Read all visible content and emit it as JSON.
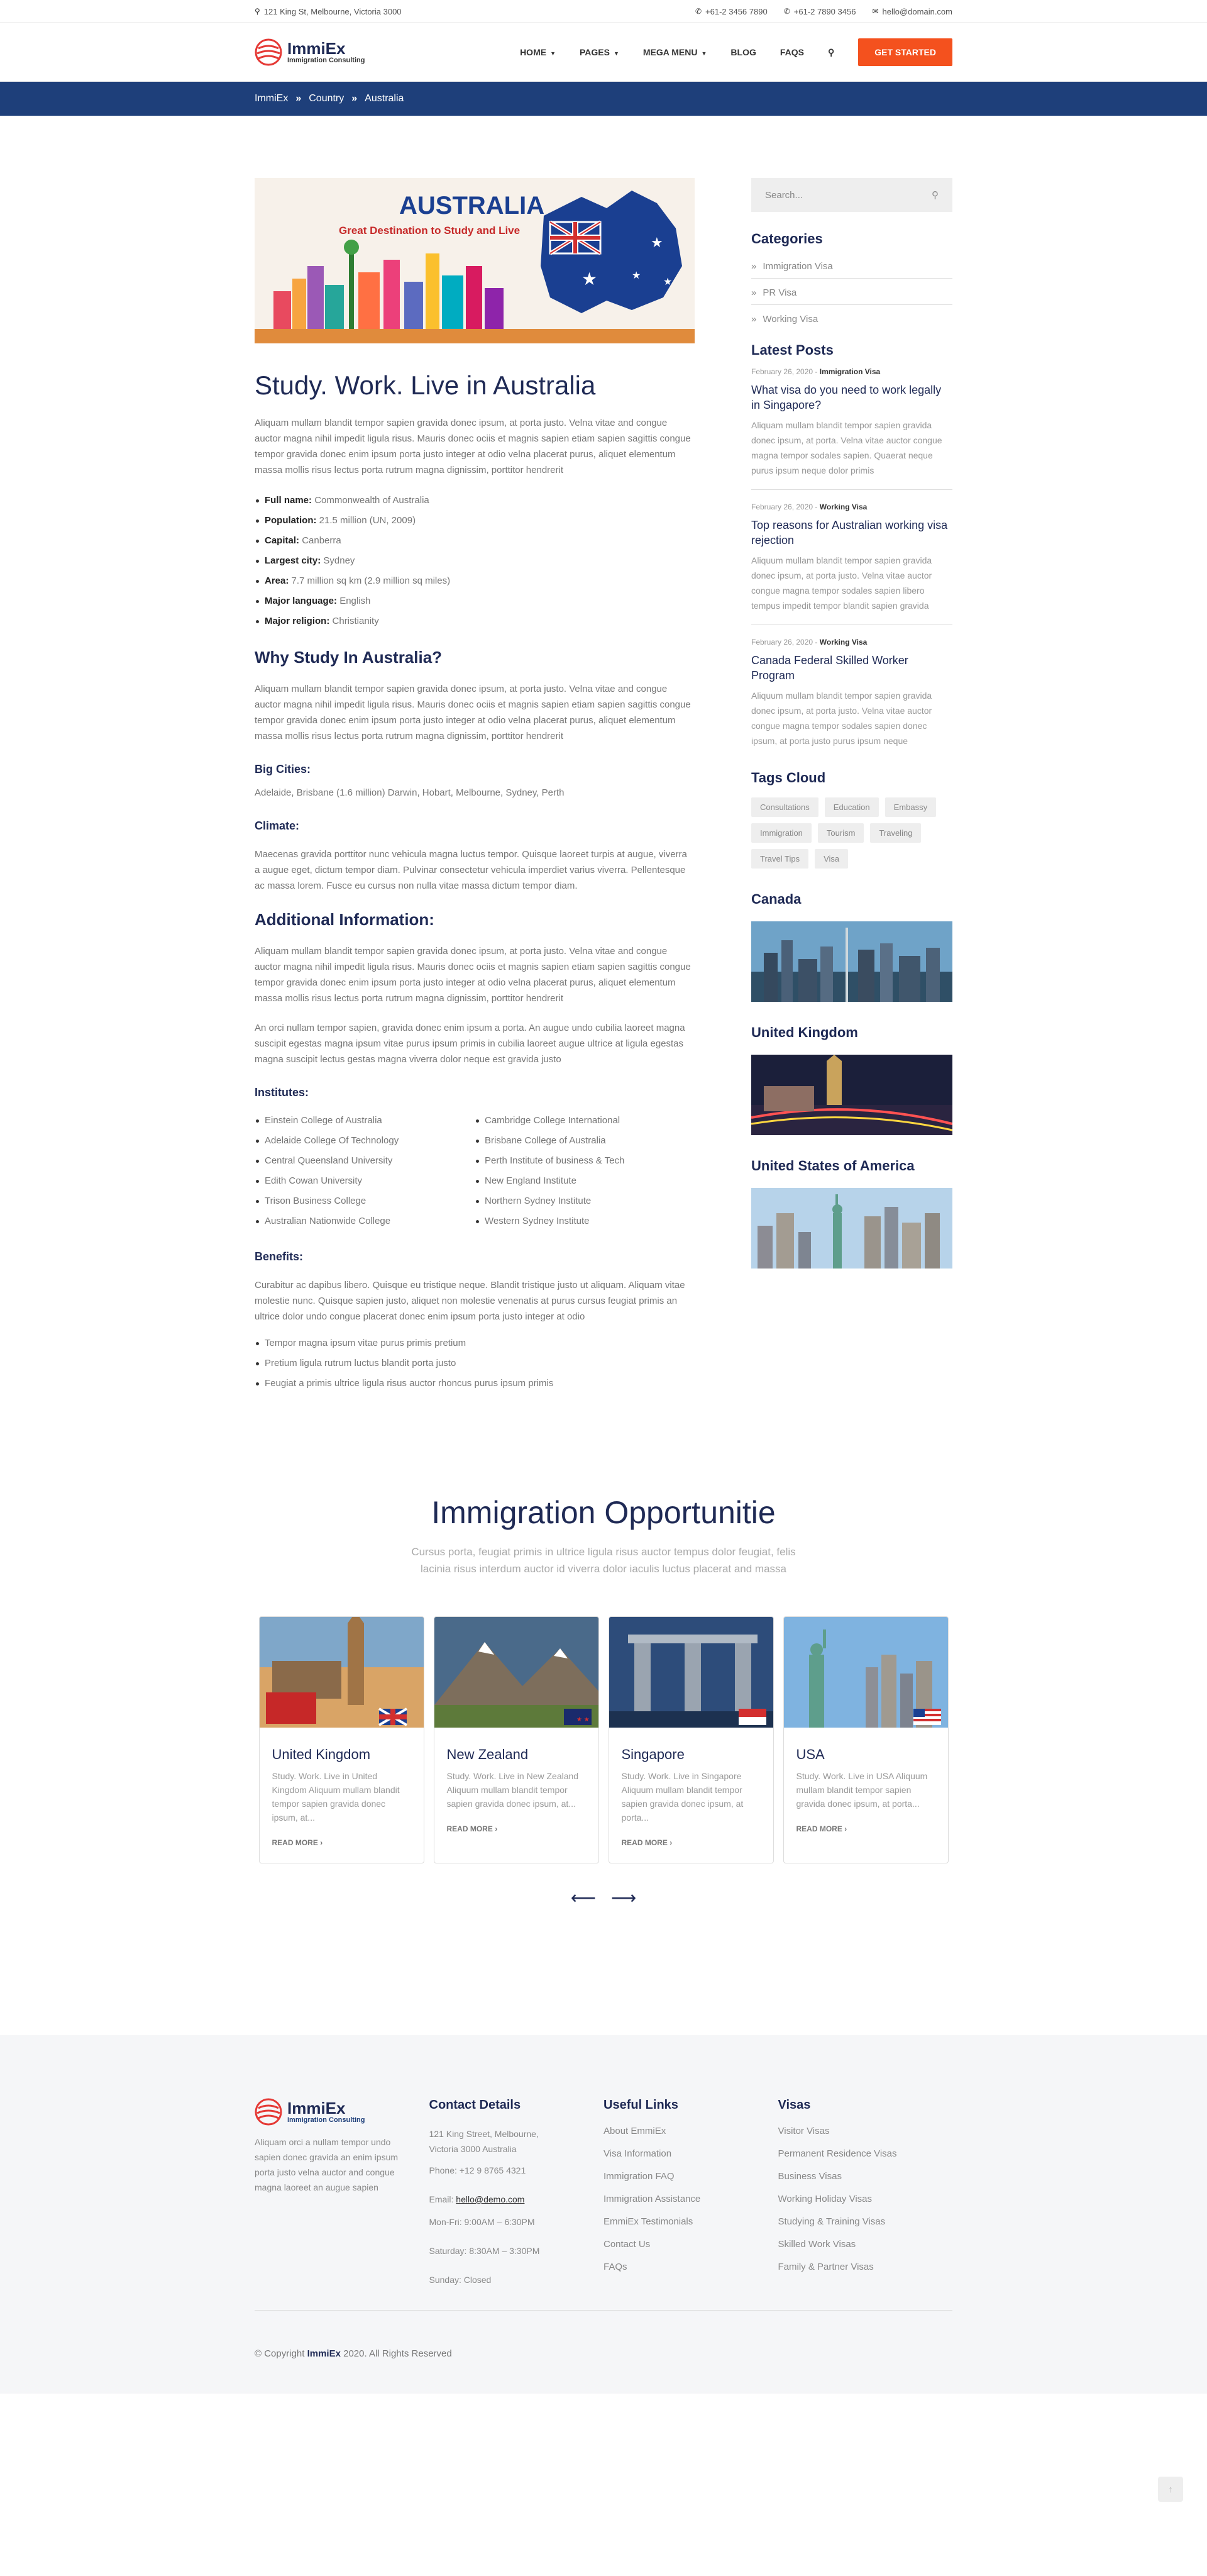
{
  "topbar": {
    "address": "121 King St, Melbourne, Victoria 3000",
    "phone1": "+61-2 3456 7890",
    "phone2": "+61-2 7890 3456",
    "email": "hello@domain.com"
  },
  "brand": {
    "name": "ImmiEx",
    "tagline": "Immigration Consulting"
  },
  "nav": {
    "home": "HOME",
    "pages": "PAGES",
    "mega": "MEGA MENU",
    "blog": "BLOG",
    "faqs": "FAQS",
    "cta": "GET STARTED"
  },
  "breadcrumb": [
    "ImmiEx",
    "Country",
    "Australia"
  ],
  "banner": {
    "title": "AUSTRALIA",
    "subtitle": "Great Destination to Study and Live"
  },
  "article": {
    "title": "Study. Work. Live in Australia",
    "intro": "Aliquam mullam blandit tempor sapien gravida donec ipsum, at porta justo. Velna vitae and congue auctor magna nihil impedit ligula risus. Mauris donec ociis et magnis sapien etiam sapien sagittis congue tempor gravida donec enim ipsum porta justo integer at odio velna placerat purus, aliquet elementum massa mollis risus lectus porta rutrum magna dignissim, porttitor hendrerit",
    "facts": [
      {
        "label": "Full name:",
        "value": "Commonwealth of Australia"
      },
      {
        "label": "Population:",
        "value": "21.5 million (UN, 2009)"
      },
      {
        "label": "Capital:",
        "value": "Canberra"
      },
      {
        "label": "Largest city:",
        "value": "Sydney"
      },
      {
        "label": "Area:",
        "value": "7.7 million sq km (2.9 million sq miles)"
      },
      {
        "label": "Major language:",
        "value": "English"
      },
      {
        "label": "Major religion:",
        "value": "Christianity"
      }
    ],
    "why_title": "Why Study In Australia?",
    "why_text": "Aliquam mullam blandit tempor sapien gravida donec ipsum, at porta justo. Velna vitae and congue auctor magna nihil impedit ligula risus. Mauris donec ociis et magnis sapien etiam sapien sagittis congue tempor gravida donec enim ipsum porta justo integer at odio velna placerat purus, aliquet elementum massa mollis risus lectus porta rutrum magna dignissim, porttitor hendrerit",
    "cities_title": "Big Cities:",
    "cities_text": "Adelaide, Brisbane (1.6 million) Darwin, Hobart, Melbourne, Sydney, Perth",
    "climate_title": "Climate:",
    "climate_text": "Maecenas gravida porttitor nunc vehicula magna luctus tempor. Quisque laoreet turpis at augue, viverra a augue eget, dictum tempor diam. Pulvinar consectetur vehicula imperdiet varius viverra. Pellentesque ac massa lorem. Fusce eu cursus non nulla vitae massa dictum tempor diam.",
    "add_title": "Additional Information:",
    "add_text1": "Aliquam mullam blandit tempor sapien gravida donec ipsum, at porta justo. Velna vitae and congue auctor magna nihil impedit ligula risus. Mauris donec ociis et magnis sapien etiam sapien sagittis congue tempor gravida donec enim ipsum porta justo integer at odio velna placerat purus, aliquet elementum massa mollis risus lectus porta rutrum magna dignissim, porttitor hendrerit",
    "add_text2": "An orci nullam tempor sapien, gravida donec enim ipsum a porta. An augue undo cubilia laoreet magna suscipit egestas magna ipsum vitae purus ipsum primis in cubilia laoreet augue ultrice at ligula egestas magna suscipit lectus gestas magna viverra dolor neque est gravida justo",
    "inst_title": "Institutes:",
    "inst_left": [
      "Einstein College of Australia",
      "Adelaide College Of Technology",
      "Central Queensland University",
      "Edith Cowan University",
      "Trison Business College",
      "Australian Nationwide College"
    ],
    "inst_right": [
      "Cambridge College International",
      "Brisbane College of Australia",
      "Perth Institute of business & Tech",
      "New England Institute",
      "Northern Sydney Institute",
      "Western Sydney Institute"
    ],
    "ben_title": "Benefits:",
    "ben_text": "Curabitur ac dapibus libero. Quisque eu tristique neque. Blandit tristique justo ut aliquam. Aliquam vitae molestie nunc. Quisque sapien justo, aliquet non molestie venenatis at purus cursus feugiat primis an ultrice dolor undo congue placerat donec enim ipsum porta justo integer at odio",
    "benefits": [
      "Tempor magna ipsum vitae purus primis pretium",
      "Pretium ligula rutrum luctus blandit porta justo",
      "Feugiat a primis ultrice ligula risus auctor rhoncus purus ipsum primis"
    ]
  },
  "sidebar": {
    "search_placeholder": "Search...",
    "categories_title": "Categories",
    "categories": [
      "Immigration Visa",
      "PR Visa",
      "Working Visa"
    ],
    "latest_title": "Latest Posts",
    "posts": [
      {
        "date": "February 26, 2020 -",
        "cat": "Immigration Visa",
        "title": "What visa do you need to work legally in Singapore?",
        "excerpt": "Aliquam mullam blandit tempor sapien gravida donec ipsum, at porta. Velna vitae auctor congue magna tempor sodales sapien. Quaerat neque purus ipsum neque dolor primis"
      },
      {
        "date": "February 26, 2020 -",
        "cat": "Working Visa",
        "title": "Top reasons for Australian working visa rejection",
        "excerpt": "Aliquum mullam blandit tempor sapien gravida donec ipsum, at porta justo. Velna vitae auctor congue magna tempor sodales sapien libero tempus impedit tempor blandit sapien gravida"
      },
      {
        "date": "February 26, 2020 -",
        "cat": "Working Visa",
        "title": "Canada Federal Skilled Worker Program",
        "excerpt": "Aliquum mullam blandit tempor sapien gravida donec ipsum, at porta justo. Velna vitae auctor congue magna tempor sodales sapien donec ipsum, at porta justo purus ipsum neque"
      }
    ],
    "tags_title": "Tags Cloud",
    "tags": [
      "Consultations",
      "Education",
      "Embassy",
      "Immigration",
      "Tourism",
      "Traveling",
      "Travel Tips",
      "Visa"
    ],
    "countries": [
      "Canada",
      "United Kingdom",
      "United States of America"
    ]
  },
  "opportunities": {
    "title": "Immigration Opportunitie",
    "subtitle": "Cursus porta, feugiat primis in ultrice ligula risus auctor tempus dolor feugiat, felis lacinia risus interdum auctor id viverra dolor iaculis luctus placerat and massa",
    "cards": [
      {
        "title": "United Kingdom",
        "excerpt": "Study. Work. Live in United Kingdom Aliquum mullam blandit tempor sapien gravida donec ipsum, at...",
        "more": "READ MORE"
      },
      {
        "title": "New Zealand",
        "excerpt": "Study. Work. Live in New Zealand Aliquum mullam blandit tempor sapien gravida donec ipsum, at...",
        "more": "READ MORE"
      },
      {
        "title": "Singapore",
        "excerpt": "Study. Work. Live in Singapore Aliquum mullam blandit tempor sapien gravida donec ipsum, at porta...",
        "more": "READ MORE"
      },
      {
        "title": "USA",
        "excerpt": "Study. Work. Live in USA Aliquum mullam blandit tempor sapien gravida donec ipsum, at porta...",
        "more": "READ MORE"
      }
    ]
  },
  "footer": {
    "about": "Aliquam orci a nullam tempor undo sapien donec gravida an enim ipsum porta justo velna auctor and congue magna laoreet an augue sapien",
    "contact_title": "Contact Details",
    "address": "121 King Street, Melbourne, Victoria 3000 Australia",
    "phone": "Phone: +12 9 8765 4321",
    "email_label": "Email:",
    "email": "hello@demo.com",
    "hours1": "Mon-Fri: 9:00AM – 6:30PM",
    "hours2": "Saturday: 8:30AM – 3:30PM",
    "hours3": "Sunday: Closed",
    "links_title": "Useful Links",
    "links": [
      "About EmmiEx",
      "Visa Information",
      "Immigration FAQ",
      "Immigration Assistance",
      "EmmiEx Testimonials",
      "Contact Us",
      "FAQs"
    ],
    "visas_title": "Visas",
    "visas": [
      "Visitor Visas",
      "Permanent Residence Visas",
      "Business Visas",
      "Working Holiday Visas",
      "Studying & Training Visas",
      "Skilled Work Visas",
      "Family & Partner Visas"
    ],
    "copy_pre": "© Copyright",
    "copy_brand": "ImmiEx",
    "copy_post": "2020. All Rights Reserved"
  },
  "colors": {
    "navy": "#1f2a55",
    "accent": "#f4511e",
    "crumb": "#1e3f7a"
  }
}
